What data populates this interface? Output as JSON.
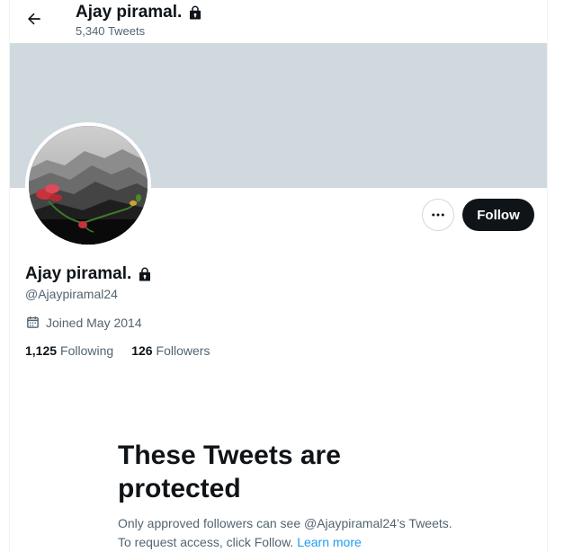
{
  "header": {
    "title": "Ajay piramal.",
    "tweets_count": "5,340",
    "tweets_label": "Tweets"
  },
  "profile": {
    "name": "Ajay piramal.",
    "handle": "@Ajaypiramal24",
    "joined": "Joined May 2014",
    "following_count": "1,125",
    "following_label": "Following",
    "followers_count": "126",
    "followers_label": "Followers"
  },
  "actions": {
    "follow_label": "Follow"
  },
  "protected": {
    "title": "These Tweets are protected",
    "body": "Only approved followers can see @Ajaypiramal24’s Tweets. To request access, click Follow.",
    "learn_more": "Learn more"
  },
  "colors": {
    "banner": "#cfd9de",
    "accent": "#1d9bf0",
    "text_secondary": "#536471"
  },
  "icons": [
    "back-arrow-icon",
    "lock-icon",
    "more-icon",
    "calendar-icon"
  ]
}
